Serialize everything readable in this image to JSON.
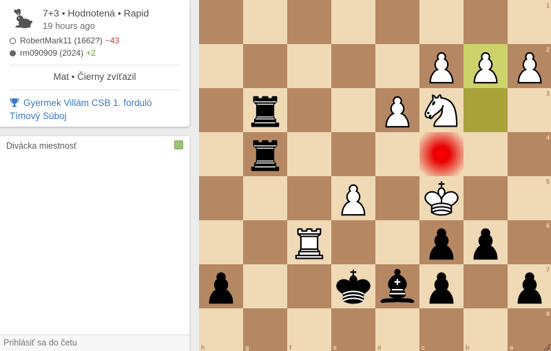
{
  "game": {
    "type": "7+3 • Hodnotená • Rapid",
    "time_ago": "19 hours ago",
    "white_player": {
      "name": "RobertMark11 (1662?)",
      "rating_diff": "−43"
    },
    "black_player": {
      "name": "rm090909 (2024)",
      "rating_diff": "+2"
    },
    "result": "Mat • Čierny zvíťazil",
    "tournament": "Gyermek Villám CSB 1. forduló Tímový Súboj"
  },
  "chat": {
    "title": "Divácka miestnosť",
    "input_placeholder": "Prihlásiť sa do četu"
  },
  "board": {
    "orientation": "black",
    "ranks": [
      "1",
      "2",
      "3",
      "4",
      "5",
      "6",
      "7",
      "8"
    ],
    "files": [
      "h",
      "g",
      "f",
      "e",
      "d",
      "c",
      "b",
      "a"
    ],
    "last_move": [
      "b2",
      "b3"
    ],
    "check_square": "c4",
    "pieces": [
      {
        "square": "c2",
        "piece": "white-pawn"
      },
      {
        "square": "b2",
        "piece": "white-pawn"
      },
      {
        "square": "a2",
        "piece": "white-pawn"
      },
      {
        "square": "g3",
        "piece": "black-rook"
      },
      {
        "square": "d3",
        "piece": "white-pawn"
      },
      {
        "square": "c3",
        "piece": "white-knight"
      },
      {
        "square": "g4",
        "piece": "black-rook"
      },
      {
        "square": "e5",
        "piece": "white-pawn"
      },
      {
        "square": "c5",
        "piece": "white-king"
      },
      {
        "square": "f6",
        "piece": "white-rook"
      },
      {
        "square": "c6",
        "piece": "black-pawn"
      },
      {
        "square": "b6",
        "piece": "black-pawn"
      },
      {
        "square": "h7",
        "piece": "black-pawn"
      },
      {
        "square": "e7",
        "piece": "black-king"
      },
      {
        "square": "d7",
        "piece": "black-bishop"
      },
      {
        "square": "c7",
        "piece": "black-pawn"
      },
      {
        "square": "a7",
        "piece": "black-pawn"
      }
    ]
  },
  "colors": {
    "light_square": "#f0d9b5",
    "dark_square": "#b58863",
    "last_move_light": "#cdd26a",
    "last_move_dark": "#aaa23a",
    "link": "#3978c2",
    "rating_loss": "#cc3333",
    "rating_gain": "#629924"
  }
}
